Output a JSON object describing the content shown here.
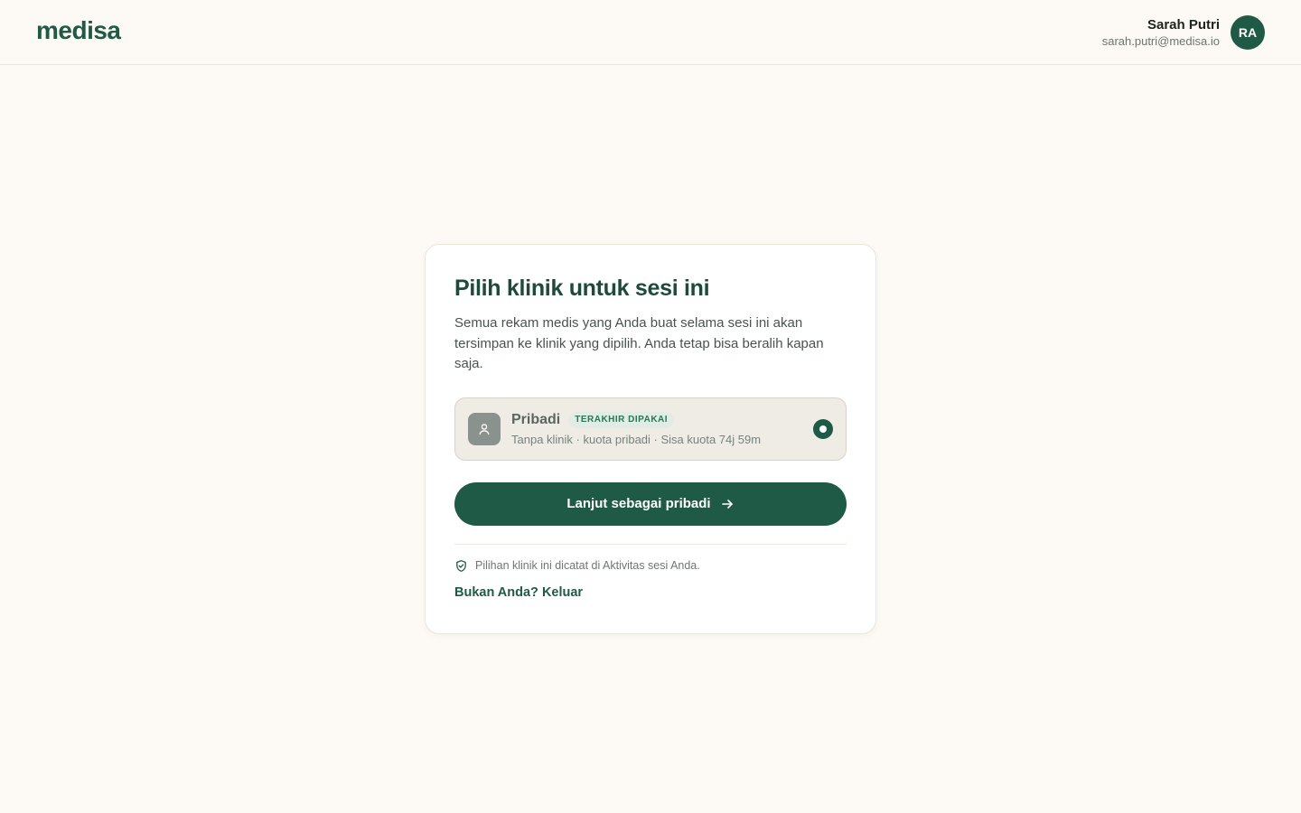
{
  "header": {
    "logo": "medisa",
    "user_name": "Sarah Putri",
    "user_email": "sarah.putri@medisa.io",
    "avatar_initials": "RA"
  },
  "card": {
    "title": "Pilih klinik untuk sesi ini",
    "description": "Semua rekam medis yang Anda buat selama sesi ini akan tersimpan ke klinik yang dipilih. Anda tetap bisa beralih kapan saja.",
    "option": {
      "icon": "person-icon",
      "title": "Pribadi",
      "badge": "TERAKHIR DIPAKAI",
      "subtitle": "Tanpa klinik · kuota pribadi · Sisa kuota 74j 59m",
      "selected": true
    },
    "cta_label": "Lanjut sebagai pribadi",
    "note": "Pilihan klinik ini dicatat di Aktivitas sesi Anda.",
    "logout_label": "Bukan Anda? Keluar"
  },
  "colors": {
    "brand": "#1f5a47",
    "background": "#fdf9f4",
    "badge_bg": "#e0ece4",
    "badge_text": "#2c7656"
  }
}
